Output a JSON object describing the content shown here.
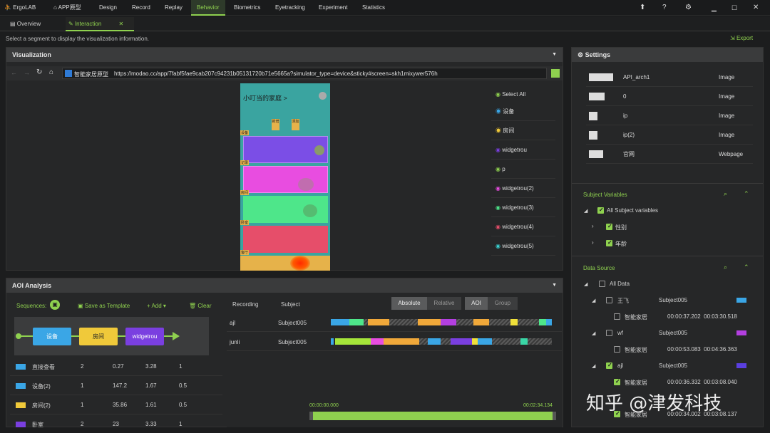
{
  "app": {
    "name": "ErgoLAB"
  },
  "nav": {
    "items": [
      "APP原型",
      "Design",
      "Record",
      "Replay",
      "Behavior",
      "Biometrics",
      "Eyetracking",
      "Experiment",
      "Statistics"
    ],
    "active": "Behavior"
  },
  "tabs": {
    "overview": "Overview",
    "interaction": "Interaction"
  },
  "hint": "Select a segment to display the visualization information.",
  "export_label": "Export",
  "visualization": {
    "title": "Visualization",
    "site_name": "智能家居原型",
    "url": "https://modao.cc/app/7fabf5fae9cab207c94231b05131720b71e5665a?simulator_type=device&sticky#screen=skh1mixywer576h",
    "phone": {
      "title": "小叮当的家庭 >",
      "btn1": "新增",
      "btn2": "添加",
      "labels": [
        "设备",
        "记录",
        "房间",
        "卧室",
        "客厅"
      ]
    },
    "aoi_list": [
      "Select All",
      "设备",
      "房间",
      "widgetrou",
      "p",
      "widgetrou(2)",
      "widgetrou(3)",
      "widgetrou(4)",
      "widgetrou(5)"
    ]
  },
  "settings": {
    "title": "Settings",
    "stimuli": [
      {
        "name": "API_arch1",
        "type": "Image"
      },
      {
        "name": "0",
        "type": "Image"
      },
      {
        "name": "ip",
        "type": "Image"
      },
      {
        "name": "ip(2)",
        "type": "Image"
      },
      {
        "name": "官网",
        "type": "Webpage"
      }
    ]
  },
  "subject_vars": {
    "title": "Subject Variables",
    "all": "All Subject variables",
    "items": [
      "性别",
      "年龄"
    ]
  },
  "data_source": {
    "title": "Data Source",
    "all": "All Data",
    "rows": [
      {
        "name": "王飞",
        "subject": "Subject005",
        "child": "智能家居",
        "time": "00:00:37.202  00:03:30.518",
        "color": "#3aa6e6",
        "checked": false
      },
      {
        "name": "wf",
        "subject": "Subject005",
        "child": "智能家居",
        "time": "00:00:53.083  00:04:36.363",
        "color": "#b33fe0",
        "checked": false
      },
      {
        "name": "ajl",
        "subject": "Subject005",
        "child": "智能家居",
        "time": "00:00:36.332  00:03:08.040",
        "color": "#5a3fe0",
        "checked": true
      },
      {
        "name": "",
        "subject": "",
        "child": "智能家居",
        "time": "00:00:34.002  00:03:08.137",
        "color": "",
        "checked": true
      }
    ]
  },
  "aoi": {
    "title": "AOI Analysis",
    "sequences": "Sequences:",
    "save_template": "Save as Template",
    "add": "Add",
    "clear": "Clear",
    "nodes": [
      "设备",
      "房间",
      "widgetrou"
    ],
    "table": [
      [
        "直接查看",
        "2",
        "0.27",
        "3.28",
        "1"
      ],
      [
        "设备(2)",
        "1",
        "147.2",
        "1.67",
        "0.5"
      ],
      [
        "房间(2)",
        "1",
        "35.86",
        "1.61",
        "0.5"
      ],
      [
        "卧室",
        "2",
        "23",
        "3.33",
        "1"
      ]
    ],
    "table_colors": [
      "#3aa6e6",
      "#3aa6e6",
      "#f0c93a",
      "#7a3fe0"
    ],
    "rec_header": {
      "recording": "Recording",
      "subject": "Subject"
    },
    "toggle": {
      "absolute": "Absolute",
      "relative": "Relative",
      "aoi": "AOI",
      "group": "Group"
    },
    "recordings": [
      {
        "name": "ajl",
        "subject": "Subject005"
      },
      {
        "name": "junli",
        "subject": "Subject005"
      }
    ],
    "time_start": "00:00:00.000",
    "time_end": "00:02:34.134"
  },
  "watermark": "知乎 @津发科技"
}
